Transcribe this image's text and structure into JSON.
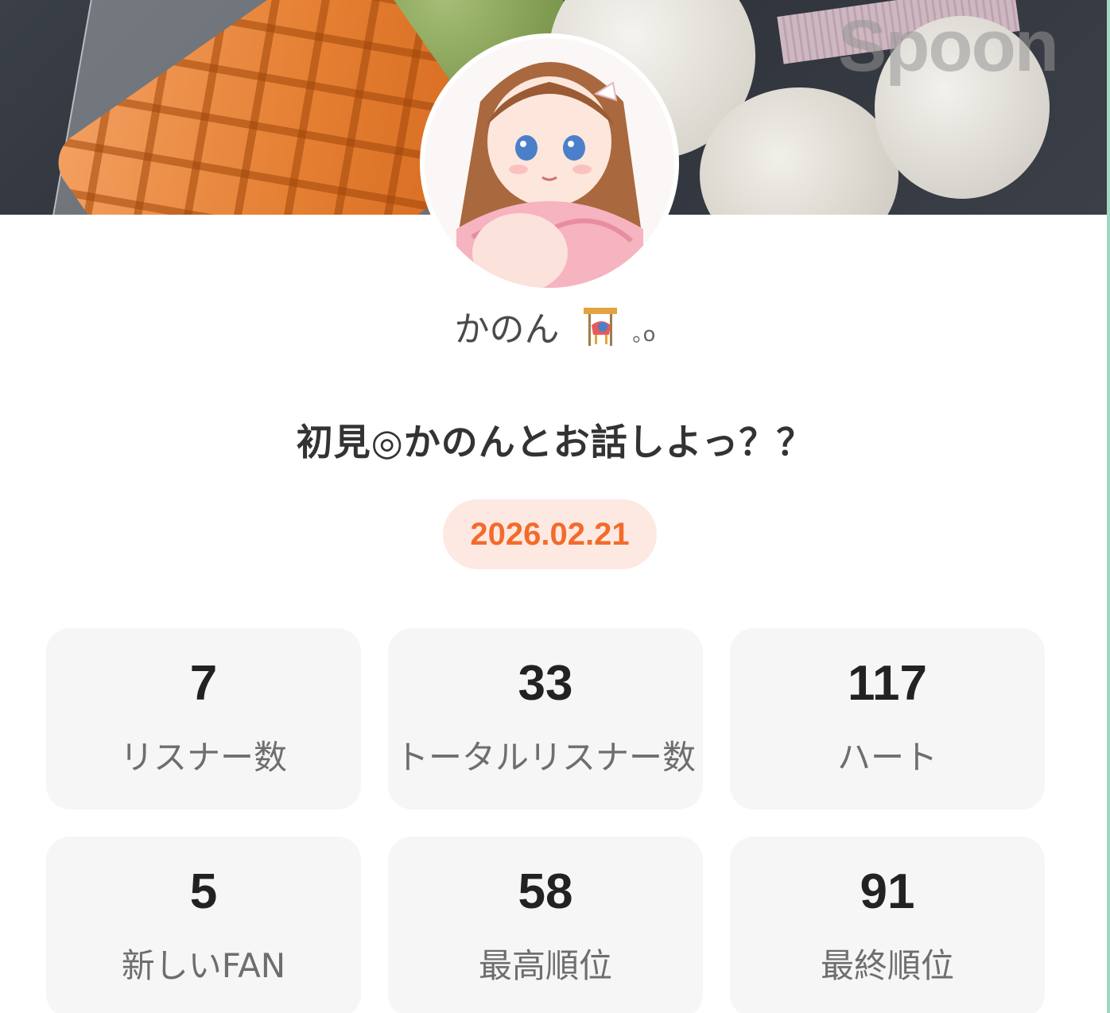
{
  "banner": {
    "watermark": "Spoon"
  },
  "profile": {
    "name": "かのん",
    "name_icon": "carousel-horse-icon",
    "name_suffix": "｡o"
  },
  "live": {
    "title": "初見◎かのんとお話しよっ？？",
    "date": "2026.02.21"
  },
  "colors": {
    "accent": "#f36b2b",
    "date_pill_bg": "#fde9e2",
    "card_bg": "#f6f6f6",
    "edge": "#9fd9c2"
  },
  "stats": [
    {
      "value": "7",
      "label": "リスナー数"
    },
    {
      "value": "33",
      "label": "トータルリスナー数"
    },
    {
      "value": "117",
      "label": "ハート"
    },
    {
      "value": "5",
      "label": "新しいFAN"
    },
    {
      "value": "58",
      "label": "最高順位"
    },
    {
      "value": "91",
      "label": "最終順位"
    }
  ]
}
